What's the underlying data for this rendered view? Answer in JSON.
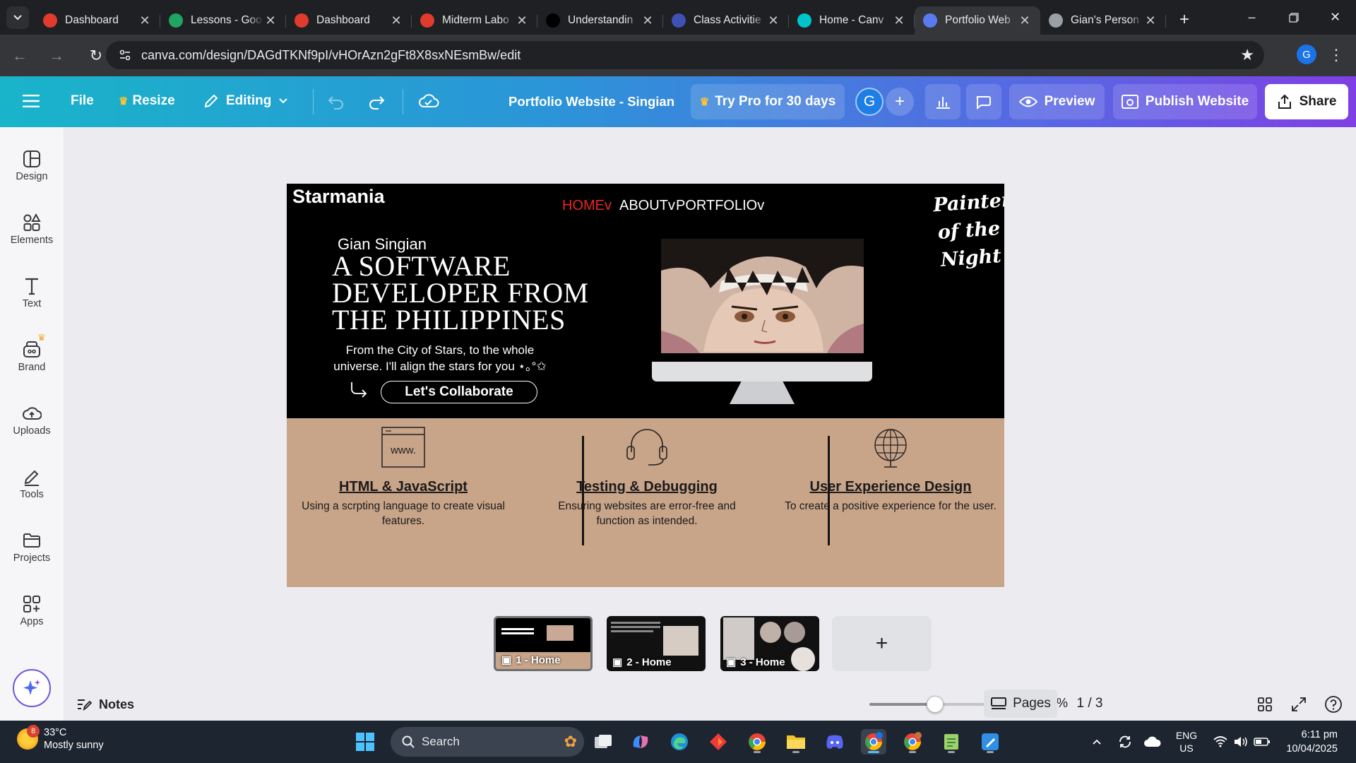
{
  "browser": {
    "tabs": [
      {
        "title": "Dashboard",
        "favicon_color": "#e03b2c",
        "favicon": "canvas-lms-icon"
      },
      {
        "title": "Lessons - Goo",
        "favicon_color": "#1fa463",
        "favicon": "google-drive-icon"
      },
      {
        "title": "Dashboard",
        "favicon_color": "#e03b2c",
        "favicon": "canvas-lms-icon"
      },
      {
        "title": "Midterm Labo",
        "favicon_color": "#e03b2c",
        "favicon": "canvas-lms-icon"
      },
      {
        "title": "Understandin",
        "favicon_color": "#000000",
        "favicon": "medium-icon"
      },
      {
        "title": "Class Activitie",
        "favicon_color": "#3f51b5",
        "favicon": "slides-icon"
      },
      {
        "title": "Home - Canv",
        "favicon_color": "#00c4cc",
        "favicon": "canva-icon"
      },
      {
        "title": "Portfolio Web",
        "favicon_color": "#5a7bf0",
        "favicon": "canva-site-icon",
        "active": true
      },
      {
        "title": "Gian's Person",
        "favicon_color": "#9aa0a6",
        "favicon": "globe-icon"
      }
    ],
    "url": "canva.com/design/DAGdTKNf9pI/vHOrAzn2gFt8X8sxNEsmBw/edit",
    "profile_initial": "G"
  },
  "toolbar": {
    "file": "File",
    "resize": "Resize",
    "editing": "Editing",
    "doc_title": "Portfolio Website - Singian",
    "try_pro": "Try Pro for 30 days",
    "avatar_initial": "G",
    "preview": "Preview",
    "publish": "Publish Website",
    "share": "Share"
  },
  "sidebar": {
    "items": [
      {
        "label": "Design",
        "icon": "design-icon"
      },
      {
        "label": "Elements",
        "icon": "elements-icon"
      },
      {
        "label": "Text",
        "icon": "text-icon"
      },
      {
        "label": "Brand",
        "icon": "brand-icon"
      },
      {
        "label": "Uploads",
        "icon": "uploads-icon"
      },
      {
        "label": "Tools",
        "icon": "tools-icon"
      },
      {
        "label": "Projects",
        "icon": "projects-icon"
      },
      {
        "label": "Apps",
        "icon": "apps-icon"
      }
    ]
  },
  "design": {
    "brand": "Starmania",
    "nav": [
      "HOMEv",
      "ABOUTv",
      "PORTFOLIOv"
    ],
    "script_title": [
      "Painter",
      "of the",
      "Night"
    ],
    "name": "Gian Singian",
    "headline": "A SOFTWARE DEVELOPER FROM THE PHILIPPINES",
    "subtitle": "From the City of Stars, to the whole universe. I'll align the stars for you ⋆｡°✩",
    "cta": "Let's Collaborate",
    "www_label": "www.",
    "services": [
      {
        "title": "HTML & JavaScript",
        "desc": "Using a scrpting language to create visual features.",
        "icon": "browser-window-icon"
      },
      {
        "title": "Testing & Debugging",
        "desc": "Ensuring websites are error-free and function as intended.",
        "icon": "headset-icon"
      },
      {
        "title": "User Experience Design",
        "desc": "To create a positive experience for the user.",
        "icon": "globe-icon"
      }
    ]
  },
  "pages": {
    "thumbs": [
      "1 - Home",
      "2 - Home",
      "3 - Home"
    ],
    "current": 1,
    "counter": "1 / 3",
    "pages_label": "Pages"
  },
  "footer": {
    "notes": "Notes",
    "zoom": "60%",
    "zoom_fraction": 0.45
  },
  "taskbar": {
    "weather_temp": "33°C",
    "weather_desc": "Mostly sunny",
    "weather_badge": "8",
    "search": "Search",
    "lang_top": "ENG",
    "lang_bottom": "US",
    "time": "6:11 pm",
    "date": "10/04/2025"
  },
  "colors": {
    "nav_active": "#e8291c",
    "toolbar_start": "#19b4c9",
    "toolbar_end": "#7f3fe5",
    "design_tan": "#c8a489"
  }
}
